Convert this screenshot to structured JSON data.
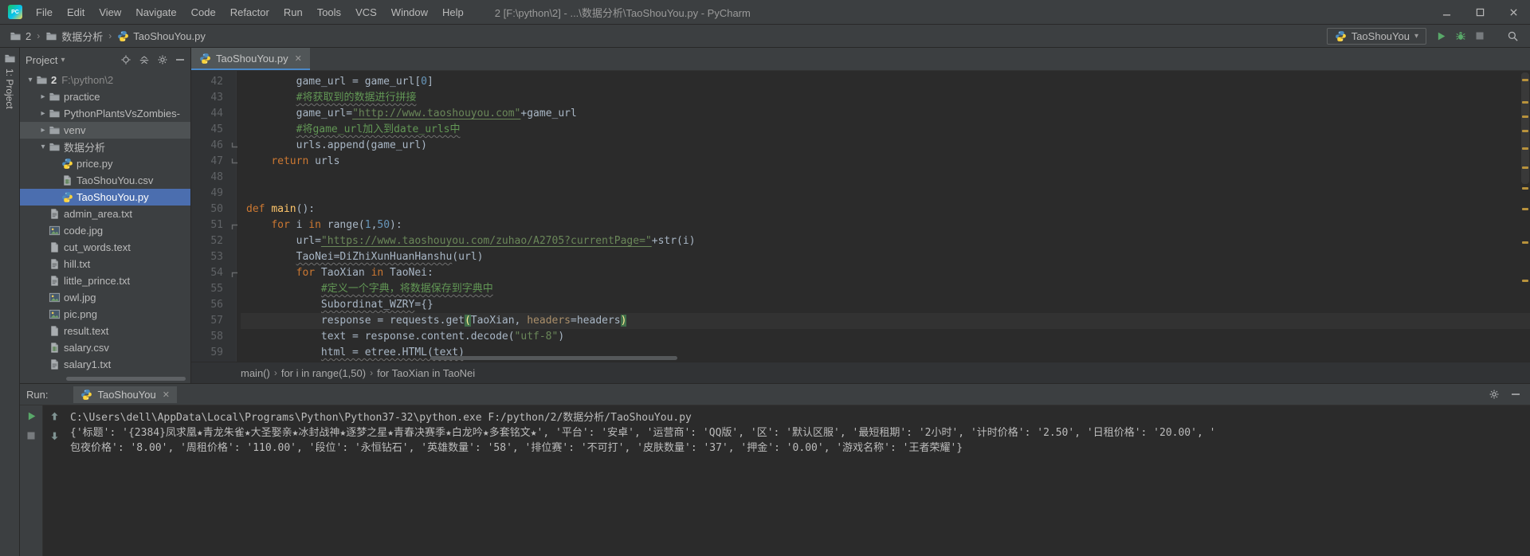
{
  "colors": {
    "panel_bg": "#3c3f41",
    "editor_bg": "#2b2b2b",
    "selection_blue": "#4b6eaf",
    "tab_underline": "#4a88c7",
    "keyword": "#cc7832",
    "string": "#6a8759",
    "comment": "#629755",
    "number": "#6897bb",
    "function": "#ffc66b",
    "named_param": "#aa8f6a",
    "plain_code": "#a9b7c6"
  },
  "title_bar": {
    "app_icon": "pycharm-logo",
    "menus": [
      "File",
      "Edit",
      "View",
      "Navigate",
      "Code",
      "Refactor",
      "Run",
      "Tools",
      "VCS",
      "Window",
      "Help"
    ],
    "title": "2 [F:\\python\\2] - ...\\数据分析\\TaoShouYou.py - PyCharm",
    "window_controls": [
      "minimize",
      "maximize",
      "close"
    ]
  },
  "toolbar": {
    "breadcrumbs": [
      {
        "label": "2",
        "icon": "folder"
      },
      {
        "label": "数据分析",
        "icon": "folder"
      },
      {
        "label": "TaoShouYou.py",
        "icon": "python"
      }
    ],
    "run_config": "TaoShouYou",
    "actions": [
      {
        "icon": "run",
        "name": "run-button"
      },
      {
        "icon": "debug",
        "name": "debug-button"
      },
      {
        "icon": "stop",
        "name": "stop-button"
      }
    ],
    "search_icon": "search-everywhere"
  },
  "tool_stripe": {
    "project_label": "1: Project",
    "icon": "folder"
  },
  "project": {
    "header": "Project",
    "header_icons": [
      {
        "icon": "locate",
        "name": "locate-file-button"
      },
      {
        "icon": "collapse",
        "name": "collapse-all-button"
      },
      {
        "icon": "gear",
        "name": "panel-settings-button"
      },
      {
        "icon": "hide",
        "name": "hide-panel-button"
      }
    ],
    "items": [
      {
        "label": "2",
        "path": "F:\\python\\2",
        "icon": "folder",
        "indent": 0,
        "expander": "down",
        "bold": true
      },
      {
        "label": "practice",
        "icon": "folder",
        "indent": 1,
        "expander": "right"
      },
      {
        "label": "PythonPlantsVsZombies-",
        "icon": "folder",
        "indent": 1,
        "expander": "right"
      },
      {
        "label": "venv",
        "icon": "folder",
        "indent": 1,
        "expander": "right",
        "soft": true
      },
      {
        "label": "数据分析",
        "icon": "folder",
        "indent": 1,
        "expander": "down"
      },
      {
        "label": "price.py",
        "icon": "python",
        "indent": 2
      },
      {
        "label": "TaoShouYou.csv",
        "icon": "csv",
        "indent": 2
      },
      {
        "label": "TaoShouYou.py",
        "icon": "python",
        "indent": 2,
        "selected": true
      },
      {
        "label": "admin_area.txt",
        "icon": "text",
        "indent": 1
      },
      {
        "label": "code.jpg",
        "icon": "image",
        "indent": 1
      },
      {
        "label": "cut_words.text",
        "icon": "file",
        "indent": 1
      },
      {
        "label": "hill.txt",
        "icon": "text",
        "indent": 1
      },
      {
        "label": "little_prince.txt",
        "icon": "text",
        "indent": 1
      },
      {
        "label": "owl.jpg",
        "icon": "image",
        "indent": 1
      },
      {
        "label": "pic.png",
        "icon": "image",
        "indent": 1
      },
      {
        "label": "result.text",
        "icon": "file",
        "indent": 1
      },
      {
        "label": "salary.csv",
        "icon": "csv",
        "indent": 1
      },
      {
        "label": "salary1.txt",
        "icon": "text",
        "indent": 1
      }
    ]
  },
  "editor": {
    "tab": {
      "label": "TaoShouYou.py",
      "icon": "python"
    },
    "breadcrumbs": [
      "main()",
      "for i in range(1,50)",
      "for TaoXian in TaoNei"
    ],
    "warning_marks_y": [
      10,
      38,
      56,
      74,
      96,
      120,
      146,
      172,
      214,
      262
    ],
    "lines": [
      {
        "n": 42,
        "tokens": [
          [
            "        game_url = game_url[",
            "p"
          ],
          [
            "0",
            "n"
          ],
          [
            "]",
            "p"
          ]
        ]
      },
      {
        "n": 43,
        "tokens": [
          [
            "        ",
            "p"
          ],
          [
            "#将获取到的数据进行拼接",
            "cu"
          ]
        ]
      },
      {
        "n": 44,
        "tokens": [
          [
            "        game_url=",
            "p"
          ],
          [
            "\"http://www.taoshouyou.com\"",
            "su"
          ],
          [
            "+game_url",
            "p"
          ]
        ]
      },
      {
        "n": 45,
        "tokens": [
          [
            "        ",
            "p"
          ],
          [
            "#将game_url加入到date_urls中",
            "cu"
          ]
        ]
      },
      {
        "n": 46,
        "fold": "end",
        "tokens": [
          [
            "        urls.append(game_url)",
            "p"
          ]
        ]
      },
      {
        "n": 47,
        "fold": "end",
        "tokens": [
          [
            "    ",
            "p"
          ],
          [
            "return",
            "k"
          ],
          [
            " urls",
            "p"
          ]
        ]
      },
      {
        "n": 48,
        "tokens": []
      },
      {
        "n": 49,
        "tokens": []
      },
      {
        "n": 50,
        "tokens": [
          [
            "def",
            "k"
          ],
          [
            " ",
            "p"
          ],
          [
            "main",
            "f"
          ],
          [
            "():",
            "p"
          ]
        ]
      },
      {
        "n": 51,
        "fold": "start",
        "tokens": [
          [
            "    ",
            "p"
          ],
          [
            "for",
            "k"
          ],
          [
            " i ",
            "p"
          ],
          [
            "in",
            "k"
          ],
          [
            " range(",
            "p"
          ],
          [
            "1",
            "n"
          ],
          [
            ",",
            "p"
          ],
          [
            "50",
            "n"
          ],
          [
            "):",
            "p"
          ]
        ]
      },
      {
        "n": 52,
        "tokens": [
          [
            "        url=",
            "p"
          ],
          [
            "\"https://www.taoshouyou.com/zuhao/A2705?currentPage=\"",
            "su"
          ],
          [
            "+str(i)",
            "p"
          ]
        ]
      },
      {
        "n": 53,
        "tokens": [
          [
            "        ",
            "p"
          ],
          [
            "TaoNei=DiZhiXunHuanHanshu",
            "pu"
          ],
          [
            "(url)",
            "p"
          ]
        ]
      },
      {
        "n": 54,
        "fold": "start",
        "tokens": [
          [
            "        ",
            "p"
          ],
          [
            "for",
            "k"
          ],
          [
            " TaoXian ",
            "p"
          ],
          [
            "in",
            "k"
          ],
          [
            " TaoNei:",
            "p"
          ]
        ]
      },
      {
        "n": 55,
        "tokens": [
          [
            "            ",
            "p"
          ],
          [
            "#定义一个字典，将数据保存到字典中",
            "cu"
          ]
        ]
      },
      {
        "n": 56,
        "tokens": [
          [
            "            ",
            "p"
          ],
          [
            "Subordinat_WZRY",
            "pu"
          ],
          [
            "={}",
            "p"
          ]
        ]
      },
      {
        "n": 57,
        "current": true,
        "tokens": [
          [
            "            response = requests.get",
            "p"
          ],
          [
            "(",
            "brace"
          ],
          [
            "TaoXian, ",
            "p"
          ],
          [
            "headers",
            "prm"
          ],
          [
            "=headers",
            "p"
          ],
          [
            ")",
            "brace"
          ]
        ]
      },
      {
        "n": 58,
        "tokens": [
          [
            "            text = response.content.decode(",
            "p"
          ],
          [
            "\"utf-8\"",
            "s"
          ],
          [
            ")",
            "p"
          ]
        ]
      },
      {
        "n": 59,
        "tokens": [
          [
            "            ",
            "p"
          ],
          [
            "html = etree.HTML(text)",
            "pu"
          ]
        ]
      }
    ]
  },
  "run_panel": {
    "label": "Run:",
    "tab": {
      "label": "TaoShouYou",
      "icon": "python"
    },
    "header_icons": [
      {
        "icon": "gear",
        "name": "run-settings-button"
      },
      {
        "icon": "hide",
        "name": "hide-run-panel-button"
      }
    ],
    "left_toolbar": [
      {
        "icon": "run",
        "name": "rerun-button"
      },
      {
        "icon": "stop",
        "name": "stop-process-button"
      }
    ],
    "console_toolbar": [
      {
        "icon": "up",
        "name": "up-stack-trace-button"
      },
      {
        "icon": "down",
        "name": "down-stack-trace-button"
      }
    ],
    "console": [
      "C:\\Users\\dell\\AppData\\Local\\Programs\\Python\\Python37-32\\python.exe F:/python/2/数据分析/TaoShouYou.py",
      "{'标题': '{2384}凤求凰★青龙朱雀★大圣娶亲★冰封战神★逐梦之星★青春决赛季★白龙吟★多套铭文★', '平台': '安卓', '运营商': 'QQ版', '区': '默认区服', '最短租期': '2小时', '计时价格': '2.50', '日租价格': '20.00', '",
      "包夜价格': '8.00', '周租价格': '110.00', '段位': '永恒钻石', '英雄数量': '58', '排位赛': '不可打', '皮肤数量': '37', '押金': '0.00', '游戏名称': '王者荣耀'}"
    ]
  }
}
